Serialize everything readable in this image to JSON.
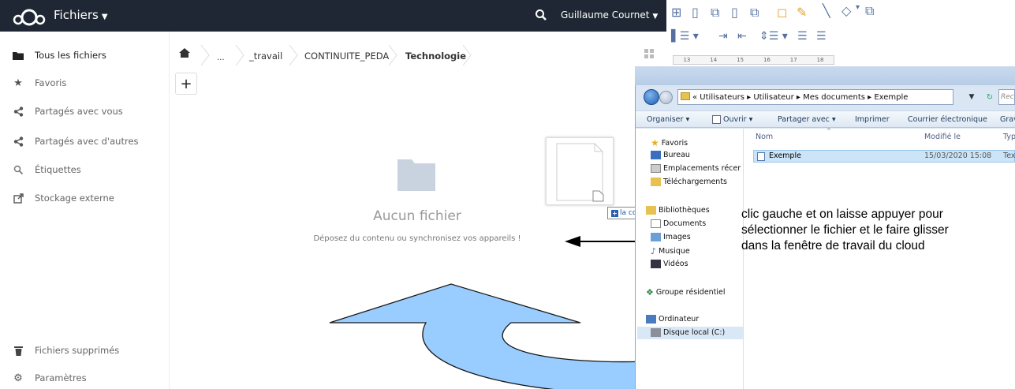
{
  "header": {
    "app_title": "Fichiers",
    "user_name": "Guillaume Cournet"
  },
  "sidebar": {
    "items": [
      {
        "label": "Tous les fichiers",
        "icon": "folder-icon"
      },
      {
        "label": "Favoris",
        "icon": "star-icon"
      },
      {
        "label": "Partagés avec vous",
        "icon": "share-icon"
      },
      {
        "label": "Partagés avec d'autres",
        "icon": "share-icon"
      },
      {
        "label": "Étiquettes",
        "icon": "tag-search-icon"
      },
      {
        "label": "Stockage externe",
        "icon": "external-storage-icon"
      }
    ],
    "trash_label": "Fichiers supprimés",
    "settings_label": "Paramètres"
  },
  "breadcrumb": {
    "ellipsis": "...",
    "items": [
      "_travail",
      "CONTINUITE_PEDA",
      "Technologie"
    ]
  },
  "empty": {
    "title": "Aucun fichier",
    "subtitle": "Déposez du contenu ou synchronisez vos appareils !"
  },
  "drag": {
    "copy_label": "la copie"
  },
  "toolbar": {
    "ruler_marks": [
      "13",
      "14",
      "15",
      "16",
      "17",
      "18"
    ]
  },
  "explorer": {
    "address": "« Utilisateurs ▸ Utilisateur ▸ Mes documents ▸ Exemple",
    "search_placeholder": "Rech",
    "commands": [
      "Organiser ▾",
      "Ouvrir ▾",
      "Partager avec ▾",
      "Imprimer",
      "Courrier électronique",
      "Grav"
    ],
    "nav": {
      "favoris": "Favoris",
      "bureau": "Bureau",
      "emplacements": "Emplacements récer",
      "telechargements": "Téléchargements",
      "bibliotheques": "Bibliothèques",
      "documents": "Documents",
      "images": "Images",
      "musique": "Musique",
      "videos": "Vidéos",
      "groupe": "Groupe résidentiel",
      "ordinateur": "Ordinateur",
      "disque": "Disque local (C:)"
    },
    "columns": {
      "name": "Nom",
      "modified": "Modifié le",
      "type": "Typ"
    },
    "file": {
      "name": "Exemple",
      "modified": "15/03/2020 15:08",
      "type": "Tex"
    }
  },
  "annotation": {
    "line1": "clic gauche et on laisse appuyer pour",
    "line2": "sélectionner le fichier et le faire glisser",
    "line3": "dans la fenêtre de travail du cloud"
  },
  "colors": {
    "header_bg": "#1e2733",
    "arrow_fill": "#99ccff",
    "folder": "#c8d3df"
  }
}
